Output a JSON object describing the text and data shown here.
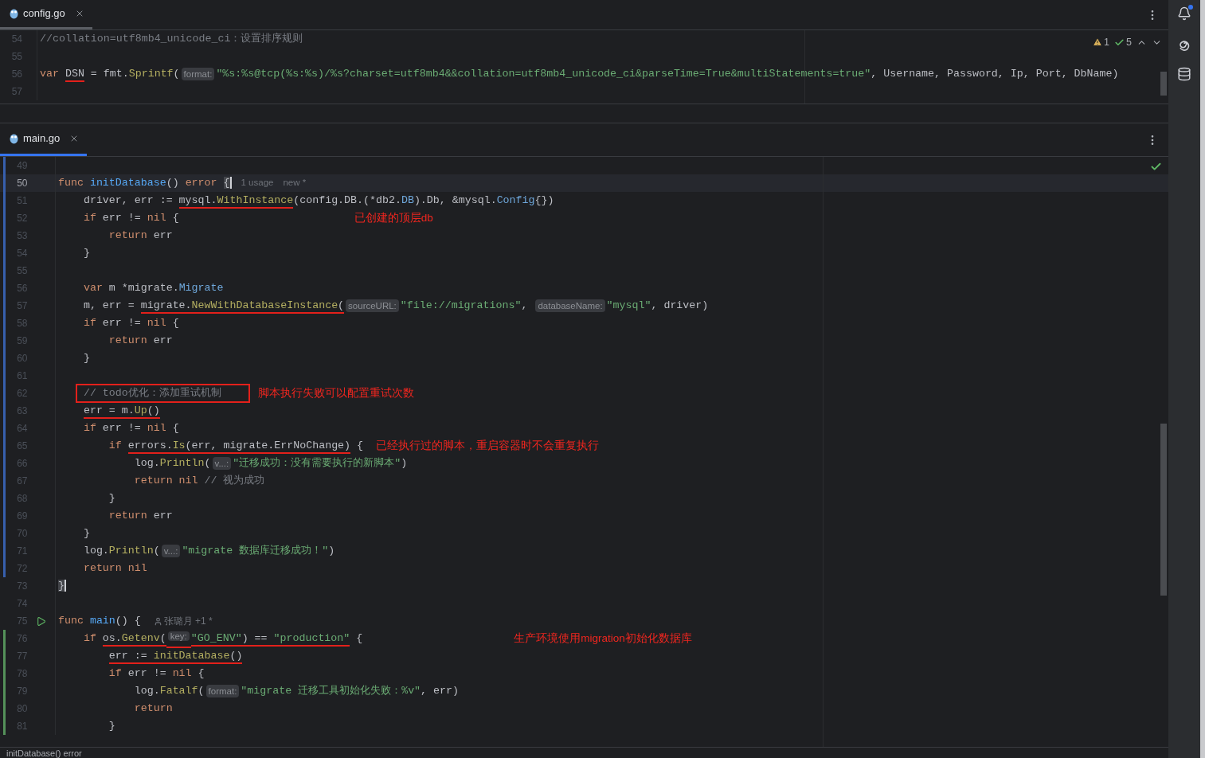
{
  "top_pane": {
    "focused": false,
    "tab": {
      "label": "config.go",
      "selected": true
    },
    "inspection": {
      "warnings": "1",
      "checks": "5"
    },
    "lines": [
      {
        "number": "54",
        "tokens": [
          {
            "text": "//collation=utf8mb4_unicode_ci：设置排序规则",
            "kind": "comment"
          }
        ]
      },
      {
        "number": "55"
      },
      {
        "number": "56",
        "tokens": [
          {
            "text": "var ",
            "kind": "kw"
          },
          {
            "text": "DSN",
            "kind": "plain",
            "underlined": true
          },
          {
            "text": " = fmt.",
            "kind": "plain"
          },
          {
            "text": "Sprintf",
            "kind": "call"
          },
          {
            "text": "(",
            "kind": "plain"
          },
          {
            "text": "format:",
            "kind": "hint"
          },
          {
            "text": "\"%s:%s@tcp(%s:%s)/%s?charset=utf8mb4&&collation=utf8mb4_unicode_ci&parseTime=True&multiStatements=true\"",
            "kind": "str"
          },
          {
            "text": ", Username, Password, Ip, Port, DbName)",
            "kind": "plain"
          }
        ]
      },
      {
        "number": "57"
      }
    ]
  },
  "bottom_pane": {
    "focused": true,
    "tab": {
      "label": "main.go",
      "selected": true
    },
    "lines": [
      {
        "number": "49",
        "modified": true
      },
      {
        "number": "50",
        "modified": true,
        "current": true,
        "tokens": [
          {
            "text": "func ",
            "kind": "kw"
          },
          {
            "text": "initDatabase",
            "kind": "fn"
          },
          {
            "text": "() ",
            "kind": "plain"
          },
          {
            "text": "error ",
            "kind": "kw"
          },
          {
            "text": "{",
            "kind": "brace"
          },
          {
            "text": "1 usage",
            "kind": "inlay"
          },
          {
            "text": "new *",
            "kind": "inlay"
          }
        ]
      },
      {
        "number": "51",
        "modified": true,
        "tokens": [
          {
            "text": "    driver, err := ",
            "kind": "plain"
          },
          {
            "text": "mysql.",
            "kind": "plain",
            "underlined": true
          },
          {
            "text": "WithInstance",
            "kind": "call",
            "underlined": true
          },
          {
            "text": "(config.DB.(*db2.",
            "kind": "plain"
          },
          {
            "text": "DB",
            "kind": "type"
          },
          {
            "text": ").Db, &mysql.",
            "kind": "plain"
          },
          {
            "text": "Config",
            "kind": "type"
          },
          {
            "text": "{})",
            "kind": "plain"
          }
        ]
      },
      {
        "number": "52",
        "modified": true,
        "note": "已创建的顶层db",
        "tokens": [
          {
            "text": "    if ",
            "kind": "kw"
          },
          {
            "text": "err != ",
            "kind": "plain"
          },
          {
            "text": "nil",
            "kind": "kw"
          },
          {
            "text": " {",
            "kind": "plain"
          }
        ]
      },
      {
        "number": "53",
        "modified": true,
        "tokens": [
          {
            "text": "        return ",
            "kind": "kw"
          },
          {
            "text": "err",
            "kind": "plain"
          }
        ]
      },
      {
        "number": "54",
        "modified": true,
        "tokens": [
          {
            "text": "    }",
            "kind": "plain"
          }
        ]
      },
      {
        "number": "55",
        "modified": true
      },
      {
        "number": "56",
        "modified": true,
        "tokens": [
          {
            "text": "    var ",
            "kind": "kw"
          },
          {
            "text": "m *migrate.",
            "kind": "plain"
          },
          {
            "text": "Migrate",
            "kind": "type"
          }
        ]
      },
      {
        "number": "57",
        "modified": true,
        "tokens": [
          {
            "text": "    m, err = ",
            "kind": "plain"
          },
          {
            "text": "migrate.",
            "kind": "plain",
            "underlined": true
          },
          {
            "text": "NewWithDatabaseInstance",
            "kind": "call",
            "underlined": true
          },
          {
            "text": "(",
            "kind": "plain",
            "underlined": true
          },
          {
            "text": "sourceURL:",
            "kind": "hint"
          },
          {
            "text": "\"file://migrations\"",
            "kind": "str"
          },
          {
            "text": ", ",
            "kind": "plain"
          },
          {
            "text": "databaseName:",
            "kind": "hint"
          },
          {
            "text": "\"mysql\"",
            "kind": "str"
          },
          {
            "text": ", driver)",
            "kind": "plain"
          }
        ]
      },
      {
        "number": "58",
        "modified": true,
        "tokens": [
          {
            "text": "    if ",
            "kind": "kw"
          },
          {
            "text": "err != ",
            "kind": "plain"
          },
          {
            "text": "nil",
            "kind": "kw"
          },
          {
            "text": " {",
            "kind": "plain"
          }
        ]
      },
      {
        "number": "59",
        "modified": true,
        "tokens": [
          {
            "text": "        return ",
            "kind": "kw"
          },
          {
            "text": "err",
            "kind": "plain"
          }
        ]
      },
      {
        "number": "60",
        "modified": true,
        "tokens": [
          {
            "text": "    }",
            "kind": "plain"
          }
        ]
      },
      {
        "number": "61",
        "modified": true
      },
      {
        "number": "62",
        "modified": true,
        "note": "脚本执行失败可以配置重试次数",
        "tokens": [
          {
            "text": "    // todo优化：添加重试机制",
            "kind": "comment",
            "boxed": true
          }
        ]
      },
      {
        "number": "63",
        "modified": true,
        "tokens": [
          {
            "text": "    err = m.",
            "kind": "plain",
            "underlined": true
          },
          {
            "text": "Up",
            "kind": "call",
            "underlined": true
          },
          {
            "text": "()",
            "kind": "plain",
            "underlined": true
          }
        ]
      },
      {
        "number": "64",
        "modified": true,
        "tokens": [
          {
            "text": "    if ",
            "kind": "kw"
          },
          {
            "text": "err != ",
            "kind": "plain"
          },
          {
            "text": "nil",
            "kind": "kw"
          },
          {
            "text": " {",
            "kind": "plain"
          }
        ]
      },
      {
        "number": "65",
        "modified": true,
        "note": "已经执行过的脚本，重启容器时不会重复执行",
        "tokens": [
          {
            "text": "        if ",
            "kind": "kw"
          },
          {
            "text": "errors.",
            "kind": "plain",
            "underlined": true
          },
          {
            "text": "Is",
            "kind": "call",
            "underlined": true
          },
          {
            "text": "(err, migrate.ErrNoChange)",
            "kind": "plain",
            "underlined": true
          },
          {
            "text": " {",
            "kind": "plain"
          }
        ]
      },
      {
        "number": "66",
        "modified": true,
        "tokens": [
          {
            "text": "            log.",
            "kind": "plain"
          },
          {
            "text": "Println",
            "kind": "call"
          },
          {
            "text": "(",
            "kind": "plain"
          },
          {
            "text": "v...:",
            "kind": "hint"
          },
          {
            "text": "\"迁移成功：没有需要执行的新脚本\"",
            "kind": "str"
          },
          {
            "text": ")",
            "kind": "plain"
          }
        ]
      },
      {
        "number": "67",
        "modified": true,
        "tokens": [
          {
            "text": "            return nil ",
            "kind": "kw"
          },
          {
            "text": "// 视为成功",
            "kind": "comment"
          }
        ]
      },
      {
        "number": "68",
        "modified": true,
        "tokens": [
          {
            "text": "        }",
            "kind": "plain"
          }
        ]
      },
      {
        "number": "69",
        "modified": true,
        "tokens": [
          {
            "text": "        return ",
            "kind": "kw"
          },
          {
            "text": "err",
            "kind": "plain"
          }
        ]
      },
      {
        "number": "70",
        "modified": true,
        "tokens": [
          {
            "text": "    }",
            "kind": "plain"
          }
        ]
      },
      {
        "number": "71",
        "modified": true,
        "tokens": [
          {
            "text": "    log.",
            "kind": "plain"
          },
          {
            "text": "Println",
            "kind": "call"
          },
          {
            "text": "(",
            "kind": "plain"
          },
          {
            "text": "v...:",
            "kind": "hint"
          },
          {
            "text": "\"migrate 数据库迁移成功！\"",
            "kind": "str"
          },
          {
            "text": ")",
            "kind": "plain"
          }
        ]
      },
      {
        "number": "72",
        "modified": true,
        "tokens": [
          {
            "text": "    return nil",
            "kind": "kw"
          }
        ]
      },
      {
        "number": "73",
        "tokens": [
          {
            "text": "}",
            "kind": "brace"
          }
        ]
      },
      {
        "number": "74"
      },
      {
        "number": "75",
        "run": true,
        "tokens": [
          {
            "text": "func ",
            "kind": "kw"
          },
          {
            "text": "main",
            "kind": "fn"
          },
          {
            "text": "() {",
            "kind": "plain"
          },
          {
            "text": "张璐月 +1 *",
            "kind": "author"
          }
        ]
      },
      {
        "number": "76",
        "added": true,
        "note": "生产环境使用migration初始化数据库",
        "tokens": [
          {
            "text": "    if ",
            "kind": "kw"
          },
          {
            "text": "os.",
            "kind": "plain",
            "underlined": true
          },
          {
            "text": "Getenv",
            "kind": "call",
            "underlined": true
          },
          {
            "text": "(",
            "kind": "plain",
            "underlined": true
          },
          {
            "text": "key:",
            "kind": "hint",
            "underlined": true
          },
          {
            "text": "\"GO_ENV\"",
            "kind": "str",
            "underlined": true
          },
          {
            "text": ") == ",
            "kind": "plain",
            "underlined": true
          },
          {
            "text": "\"production\"",
            "kind": "str",
            "underlined": true
          },
          {
            "text": " {",
            "kind": "plain"
          }
        ]
      },
      {
        "number": "77",
        "added": true,
        "tokens": [
          {
            "text": "        err := ",
            "kind": "plain",
            "underlined": true
          },
          {
            "text": "initDatabase",
            "kind": "call",
            "underlined": true
          },
          {
            "text": "()",
            "kind": "plain",
            "underlined": true
          }
        ]
      },
      {
        "number": "78",
        "added": true,
        "tokens": [
          {
            "text": "        if ",
            "kind": "kw"
          },
          {
            "text": "err != ",
            "kind": "plain"
          },
          {
            "text": "nil",
            "kind": "kw"
          },
          {
            "text": " {",
            "kind": "plain"
          }
        ]
      },
      {
        "number": "79",
        "added": true,
        "tokens": [
          {
            "text": "            log.",
            "kind": "plain"
          },
          {
            "text": "Fatalf",
            "kind": "call"
          },
          {
            "text": "(",
            "kind": "plain"
          },
          {
            "text": "format:",
            "kind": "hint"
          },
          {
            "text": "\"migrate 迁移工具初始化失败：%v\"",
            "kind": "str"
          },
          {
            "text": ", err)",
            "kind": "plain"
          }
        ]
      },
      {
        "number": "80",
        "added": true,
        "tokens": [
          {
            "text": "            return",
            "kind": "kw"
          }
        ]
      },
      {
        "number": "81",
        "added": true,
        "tokens": [
          {
            "text": "        }",
            "kind": "plain"
          }
        ]
      }
    ]
  },
  "status_bar": {
    "text": "initDatabase() error"
  }
}
